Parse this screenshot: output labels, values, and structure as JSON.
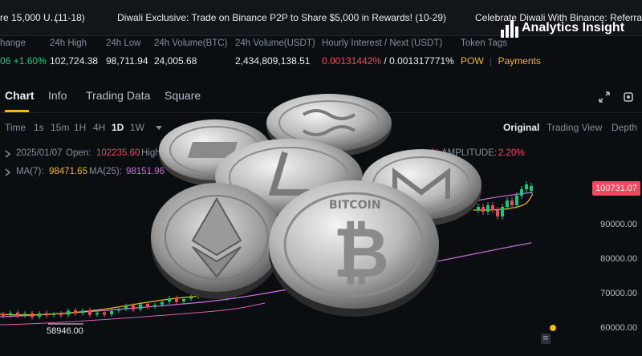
{
  "ticker": {
    "item1": "re 15,000 U...",
    "item1_date": "(11-18)",
    "item2": "Diwali Exclusive: Trade on Binance P2P to Share $5,000 in Rewards! (10-29)",
    "item3": "Celebrate Diwali With Binance: Referral D"
  },
  "watermark": {
    "text": "Analytics Insight"
  },
  "stats": {
    "change": {
      "label": "hange",
      "value": "06 +1.60%"
    },
    "high": {
      "label": "24h High",
      "value": "102,724.38"
    },
    "low": {
      "label": "24h Low",
      "value": "98,711.94"
    },
    "vol_btc": {
      "label": "24h Volume(BTC)",
      "value": "24,005.68"
    },
    "vol_usdt": {
      "label": "24h Volume(USDT)",
      "value": "2,434,809,138.51"
    },
    "interest": {
      "label": "Hourly Interest / Next (USDT)",
      "value1": "0.00131442%",
      "sep": " / ",
      "value2": "0.001317771%"
    },
    "tags": {
      "label": "Token Tags",
      "tag1": "POW",
      "sep": "|",
      "tag2": "Payments"
    }
  },
  "tabs": [
    "Chart",
    "Info",
    "Trading Data",
    "Square"
  ],
  "toolbar": {
    "time": "Time",
    "intervals": [
      "1s",
      "15m",
      "1H",
      "4H",
      "1D",
      "1W"
    ],
    "active_interval": "1D",
    "views": [
      "Original",
      "Trading View",
      "Depth"
    ],
    "active_view": "Original"
  },
  "ohlc": {
    "date": "2025/01/07",
    "open_label": "Open:",
    "open_value": "102235.60",
    "high_label": "High",
    "change_pct": "%",
    "amplitude_label": "AMPLITUDE:",
    "amplitude_value": "2.20%"
  },
  "ma": {
    "ma7_label": "MA(7):",
    "ma7_value": "98471.65",
    "ma25_label": "MA(25):",
    "ma25_value": "98151.96"
  },
  "price_axis": [
    "90000.00",
    "80000.00",
    "70000.00",
    "60000.00"
  ],
  "current_price": "100731.07",
  "low_marker": "58946.00",
  "coins": [
    {
      "name": "Ripple",
      "icon": "ripple-coin-icon"
    },
    {
      "name": "Dash",
      "icon": "dash-coin-icon"
    },
    {
      "name": "Litecoin",
      "icon": "litecoin-coin-icon"
    },
    {
      "name": "Monero",
      "icon": "monero-coin-icon"
    },
    {
      "name": "Ethereum",
      "icon": "ethereum-coin-icon"
    },
    {
      "name": "Bitcoin",
      "icon": "bitcoin-coin-icon",
      "text": "BITCOIN"
    }
  ],
  "colors": {
    "green": "#0ecb81",
    "red": "#f6465d",
    "yellow": "#f0b90b",
    "bg": "#0b0e11"
  }
}
